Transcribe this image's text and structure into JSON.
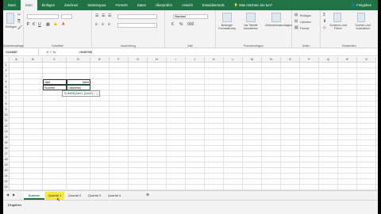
{
  "ribbon_tabs": [
    {
      "label": "Datei",
      "active": false
    },
    {
      "label": "Start",
      "active": true
    },
    {
      "label": "Einfügen",
      "active": false
    },
    {
      "label": "Zeichnen",
      "active": false
    },
    {
      "label": "Seitenlayout",
      "active": false
    },
    {
      "label": "Formeln",
      "active": false
    },
    {
      "label": "Daten",
      "active": false
    },
    {
      "label": "Überprüfen",
      "active": false
    },
    {
      "label": "Ansicht",
      "active": false
    },
    {
      "label": "Entwicklertools",
      "active": false
    }
  ],
  "tell_me": "Was möchten Sie tun?",
  "share_label": "Freigeben",
  "ribbon_groups": {
    "clipboard": "Zwischenablage",
    "font": "Schriftart",
    "alignment": "Ausrichtung",
    "number": "Zahl",
    "styles": "Formatvorlagen",
    "cells": "Zellen",
    "editing": "Bearbeiten"
  },
  "ribbon_controls": {
    "paste": "Einfügen",
    "number_format": "Standard",
    "conditional_format": "Bedingte Formatierung",
    "format_as_table": "Als Tabelle formatieren",
    "cell_styles": "Zellenformatvorlagen",
    "insert": "Einfügen",
    "delete": "Löschen",
    "format": "Format",
    "sort_filter": "Sortieren und Filtern",
    "find_select": "Suchen und Auswählen"
  },
  "formula_bar": {
    "name_box": "SUMME",
    "formula": "=summe("
  },
  "columns": [
    "A",
    "B",
    "C",
    "D",
    "E",
    "F",
    "G",
    "H",
    "I",
    "J",
    "K",
    "L",
    "M",
    "N",
    "O",
    "P",
    "Q",
    "R",
    "S"
  ],
  "rows": [
    "1",
    "2",
    "3",
    "4",
    "5",
    "6",
    "7",
    "8",
    "9",
    "10",
    "11",
    "12",
    "13",
    "14",
    "15",
    "16",
    "17",
    "18",
    "19",
    "20",
    "21",
    "22",
    "23"
  ],
  "cells": {
    "c4": "Jahr",
    "d4": "Wert",
    "c5": "Summe",
    "d5": "=summe("
  },
  "tooltip": "SUMME(Zahl1; [Zahl2]; ...)",
  "sheet_tabs": [
    {
      "label": "Summe",
      "active": true,
      "highlight": false
    },
    {
      "label": "Quartal 1",
      "active": false,
      "highlight": true
    },
    {
      "label": "Quartal 2",
      "active": false,
      "highlight": false
    },
    {
      "label": "Quartal 3",
      "active": false,
      "highlight": false
    },
    {
      "label": "Quartal 4",
      "active": false,
      "highlight": false
    }
  ],
  "status_text": "Eingeben",
  "accent_color": "#217346"
}
